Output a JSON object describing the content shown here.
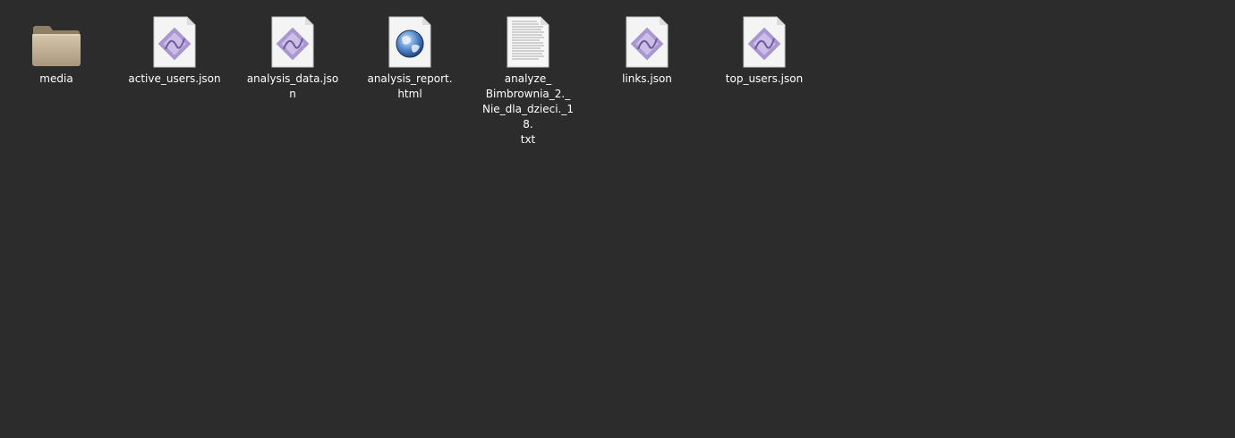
{
  "desktop": {
    "items": [
      {
        "type": "folder",
        "icon": "folder-icon",
        "label_lines": [
          "media"
        ]
      },
      {
        "type": "json",
        "icon": "json-file-icon",
        "label_lines": [
          "active_users.json"
        ]
      },
      {
        "type": "json",
        "icon": "json-file-icon",
        "label_lines": [
          "analysis_data.json"
        ]
      },
      {
        "type": "html",
        "icon": "html-file-globe-icon",
        "label_lines": [
          "analysis_report.",
          "html"
        ]
      },
      {
        "type": "txt",
        "icon": "text-file-icon",
        "label_lines": [
          "analyze_",
          "Bimbrownia_2._",
          "Nie_dla_dzieci._18.",
          "txt"
        ]
      },
      {
        "type": "json",
        "icon": "json-file-icon",
        "label_lines": [
          "links.json"
        ]
      },
      {
        "type": "json",
        "icon": "json-file-icon",
        "label_lines": [
          "top_users.json"
        ]
      }
    ]
  },
  "colors": {
    "background": "#2c2c2c",
    "label": "#ffffff",
    "folder": "#bfae94",
    "json_diamond": "#9e8bc4"
  }
}
